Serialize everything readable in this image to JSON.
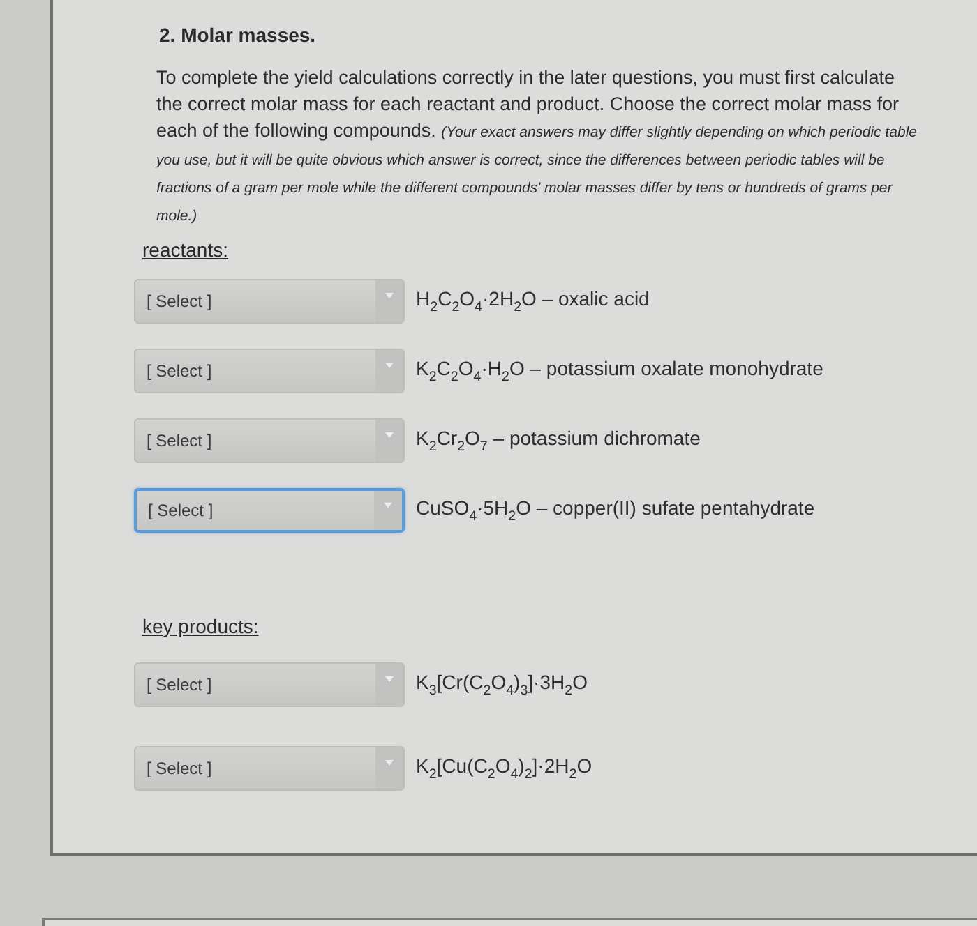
{
  "question": {
    "title": "2. Molar masses.",
    "text": "To complete the yield calculations correctly in the later questions, you must first calculate the correct molar mass for each reactant and product. Choose the correct molar mass for each of the following compounds. *(Your exact answers may differ slightly depending on which periodic table you use, but it will be quite obvious which answer is correct, since the differences between periodic tables will be fractions of a gram per mole while the different compounds' molar masses differ by tens or hundreds of grams per mole.)*"
  },
  "sections": [
    {
      "label": "reactants:",
      "items": [
        {
          "placeholder": "[ Select ]",
          "compound": "H$_{2}$C$_{2}$O$_{4}$·2H$_{2}$O – oxalic acid",
          "focused": false
        },
        {
          "placeholder": "[ Select ]",
          "compound": "K$_{2}$C$_{2}$O$_{4}$·H$_{2}$O – potassium oxalate monohydrate",
          "focused": false
        },
        {
          "placeholder": "[ Select ]",
          "compound": "K$_{2}$Cr$_{2}$O$_{7}$ – potassium dichromate",
          "focused": false
        },
        {
          "placeholder": "[ Select ]",
          "compound": "CuSO$_{4}$·5H$_{2}$O – copper(II) sufate pentahydrate",
          "focused": true
        }
      ]
    },
    {
      "label": "key products:",
      "items": [
        {
          "placeholder": "[ Select ]",
          "compound": "K$_{3}$[Cr(C$_{2}$O$_{4}$)$_{3}$]·3H$_{2}$O",
          "focused": false
        },
        {
          "placeholder": "[ Select ]",
          "compound": "K$_{2}$[Cu(C$_{2}$O$_{4}$)$_{2}$]·2H$_{2}$O",
          "focused": false
        }
      ]
    }
  ]
}
